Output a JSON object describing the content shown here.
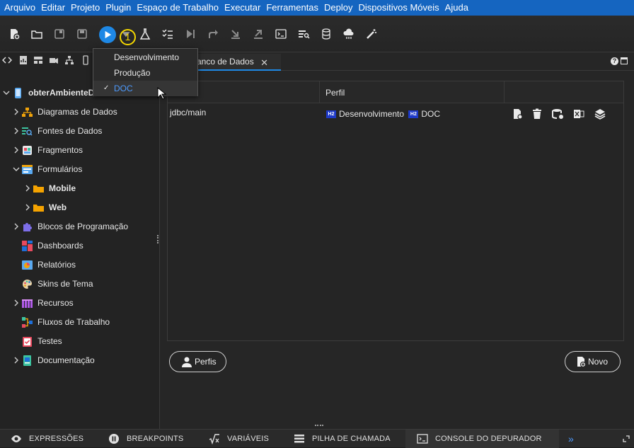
{
  "menu": [
    "Arquivo",
    "Editar",
    "Projeto",
    "Plugin",
    "Espaço de Trabalho",
    "Executar",
    "Ferramentas",
    "Deploy",
    "Dispositivos Móveis",
    "Ajuda"
  ],
  "toolbar": {
    "badge": "1",
    "icons": [
      "new-file-icon",
      "open-folder-icon",
      "save-icon",
      "save-all-icon",
      "run-icon",
      "run-dropdown-icon",
      "flask-icon",
      "checklist-icon",
      "step-over-icon",
      "share-icon",
      "download-icon",
      "upload-icon",
      "terminal-icon",
      "database-search-icon",
      "database-icon",
      "cloud-icon",
      "magic-wand-icon"
    ],
    "accent": "#1e88e5",
    "badge_color": "#f5d800"
  },
  "dropdown": {
    "items": [
      "Desenvolvimento",
      "Produção",
      "DOC"
    ],
    "selected": "DOC",
    "check": "✓"
  },
  "tree": {
    "root": "obterAmbienteDoc",
    "items": [
      {
        "label": "Diagramas de Dados",
        "icon": "diagram-icon"
      },
      {
        "label": "Fontes de Dados",
        "icon": "datasource-icon"
      },
      {
        "label": "Fragmentos",
        "icon": "fragment-icon"
      },
      {
        "label": "Formulários",
        "icon": "form-icon"
      },
      {
        "label": "Mobile",
        "icon": "folder-icon"
      },
      {
        "label": "Web",
        "icon": "folder-icon"
      },
      {
        "label": "Blocos de Programação",
        "icon": "puzzle-icon"
      },
      {
        "label": "Dashboards",
        "icon": "dashboard-icon"
      },
      {
        "label": "Relatórios",
        "icon": "report-icon"
      },
      {
        "label": "Skins de Tema",
        "icon": "palette-icon"
      },
      {
        "label": "Recursos",
        "icon": "resources-icon"
      },
      {
        "label": "Fluxos de Trabalho",
        "icon": "workflow-icon"
      },
      {
        "label": "Testes",
        "icon": "tests-icon"
      },
      {
        "label": "Documentação",
        "icon": "book-icon"
      }
    ]
  },
  "tab": {
    "label": "anco de Dados",
    "close": "✕"
  },
  "table": {
    "headers": [
      "",
      "Perfil",
      ""
    ],
    "rows": [
      {
        "name": "jdbc/main",
        "profiles": [
          "Desenvolvimento",
          "DOC"
        ],
        "chip": "H2"
      }
    ]
  },
  "buttons": {
    "profiles": "Perfis",
    "new": "Novo"
  },
  "bottom": {
    "items": [
      "EXPRESSÕES",
      "BREAKPOINTS",
      "VARIÁVEIS",
      "PILHA DE CHAMADA",
      "CONSOLE DO DEPURADOR"
    ],
    "more": "»"
  }
}
